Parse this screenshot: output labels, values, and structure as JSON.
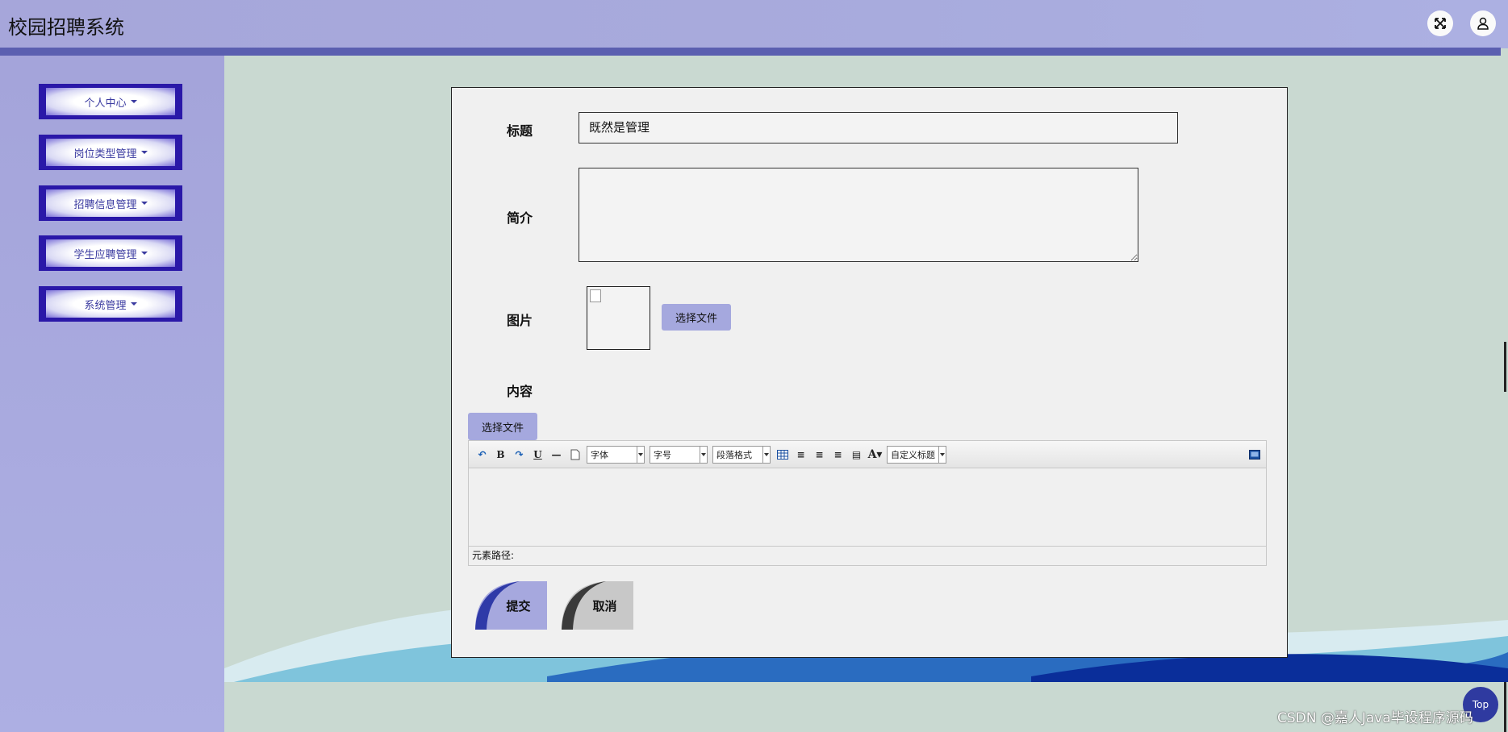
{
  "header": {
    "title": "校园招聘系统",
    "fullscreen_icon": "expand-arrows-icon",
    "user_icon": "user-icon",
    "accent_color": "#5b5fb0"
  },
  "sidebar": {
    "items": [
      {
        "label": "个人中心"
      },
      {
        "label": "岗位类型管理"
      },
      {
        "label": "招聘信息管理"
      },
      {
        "label": "学生应聘管理"
      },
      {
        "label": "系统管理"
      }
    ]
  },
  "form": {
    "title_label": "标题",
    "title_value": "既然是管理",
    "summary_label": "简介",
    "summary_value": "",
    "image_label": "图片",
    "image_upload_label": "选择文件",
    "content_label": "内容",
    "content_upload_label": "选择文件"
  },
  "editor": {
    "font_select": "字体",
    "size_select": "字号",
    "paragraph_select": "段落格式",
    "custom_title_select": "自定义标题",
    "element_path_label": "元素路径:"
  },
  "actions": {
    "submit_label": "提交",
    "cancel_label": "取消"
  },
  "footer": {
    "top_label": "Top",
    "watermark": "CSDN @嘉人Java毕设程序源码"
  }
}
